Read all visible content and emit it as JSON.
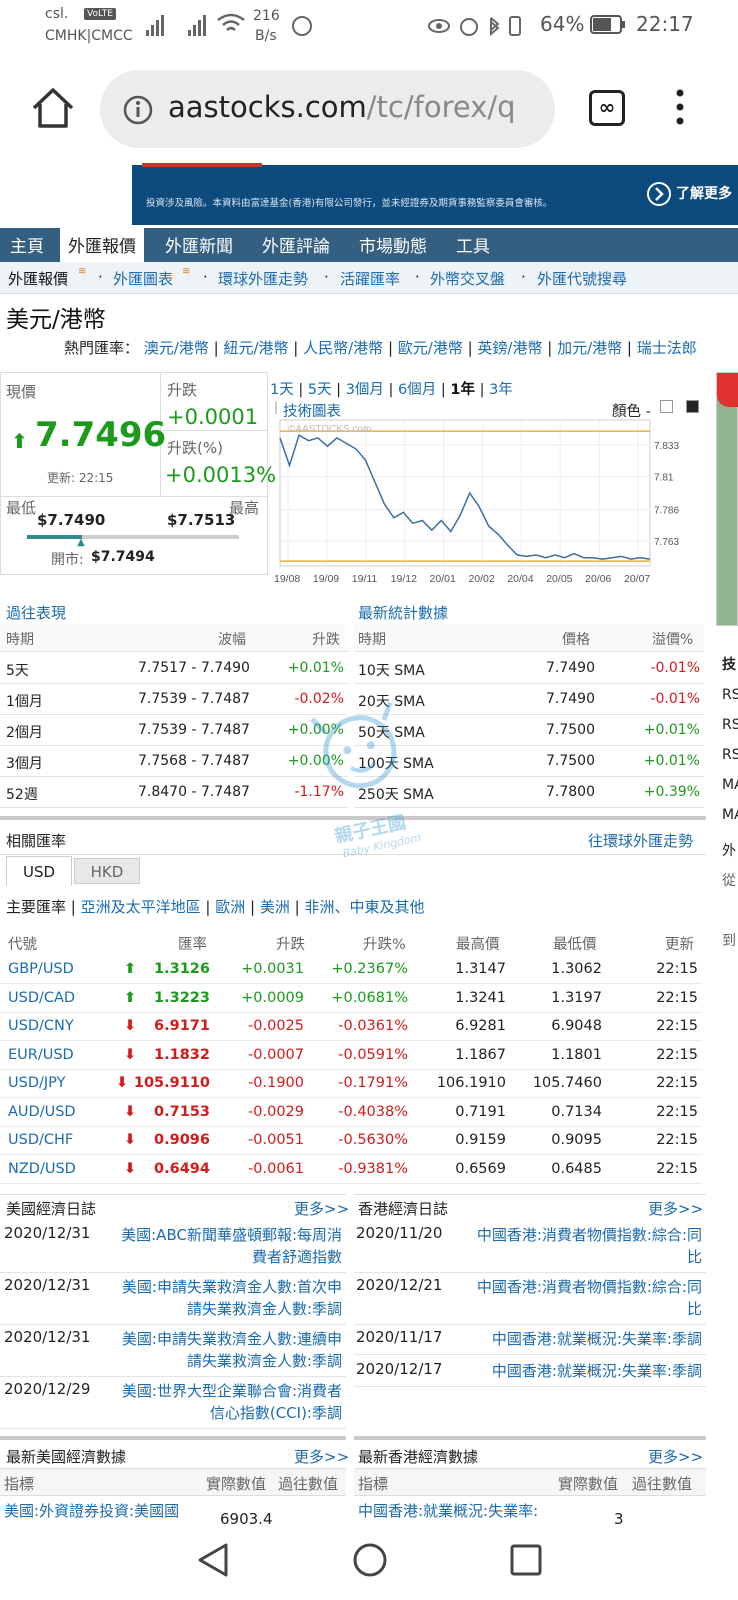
{
  "status": {
    "carrier1": "csl.",
    "volte": "VoLTE",
    "carrier2": "CMHK|CMCC",
    "speed1": "216",
    "speed2": "B/s",
    "battery": "64%",
    "time": "22:17"
  },
  "browser": {
    "url_host": "aastocks.com",
    "url_path": "/tc/forex/q",
    "tabs_icon": "∞"
  },
  "banner": {
    "text": "投資涉及風險。本資料由富達基金(香港)有限公司發行，並未經證券及期貨事務監察委員會審核。",
    "cta": "了解更多"
  },
  "nav": {
    "items": [
      "主頁",
      "外匯報價",
      "外匯新聞",
      "外匯評論",
      "市場動態",
      "工具"
    ]
  },
  "subnav": {
    "items": [
      "外匯報價",
      "外匯圖表",
      "環球外匯走勢",
      "活躍匯率",
      "外幣交叉盤",
      "外匯代號搜尋"
    ]
  },
  "pair": {
    "title": "美元/港幣",
    "hot_label": "熱門匯率：",
    "hot_links": [
      "澳元/港幣",
      "紐元/港幣",
      "人民幣/港幣",
      "歐元/港幣",
      "英鎊/港幣",
      "加元/港幣",
      "瑞士法郎"
    ]
  },
  "quote": {
    "price_label": "現價",
    "price": "7.7496",
    "updated": "更新: 22:15",
    "change_label": "升跌",
    "change": "+0.0001",
    "pct_label": "升跌(%)",
    "pct": "+0.0013%",
    "low_label": "最低",
    "low": "$7.7490",
    "high_label": "最高",
    "high": "$7.7513",
    "open_label": "開市:",
    "open": "$7.7494",
    "range_position": 0.26
  },
  "chart": {
    "periods": [
      "1天",
      "5天",
      "3個月",
      "6個月",
      "1年",
      "3年"
    ],
    "active_period": "1年",
    "tech_link": "技術圖表",
    "color_label": "顏色 -",
    "watermark": "©AASTOCKS.com",
    "x_ticks": [
      "19/08",
      "19/09",
      "19/11",
      "19/12",
      "20/01",
      "20/02",
      "20/04",
      "20/05",
      "20/06",
      "20/07"
    ],
    "y_ticks": [
      "7.833",
      "7.810",
      "7.786",
      "7.763"
    ]
  },
  "chart_data": {
    "type": "line",
    "ylim": [
      7.745,
      7.851
    ],
    "x": [
      "19/08",
      "19/09",
      "19/11",
      "19/12",
      "20/01",
      "20/02",
      "20/04",
      "20/05",
      "20/06",
      "20/07"
    ],
    "series": [
      {
        "values": [
          7.838,
          7.818,
          7.84,
          7.836,
          7.838,
          7.832,
          7.838,
          7.834,
          7.83,
          7.822,
          7.806,
          7.79,
          7.78,
          7.784,
          7.776,
          7.778,
          7.771,
          7.778,
          7.77,
          7.782,
          7.798,
          7.788,
          7.774,
          7.768,
          7.76,
          7.753,
          7.752,
          7.753,
          7.751,
          7.753,
          7.751,
          7.754,
          7.751,
          7.751,
          7.75,
          7.751,
          7.752,
          7.75,
          7.751,
          7.75
        ]
      }
    ],
    "y_ticks": [
      7.833,
      7.81,
      7.786,
      7.763
    ]
  },
  "past": {
    "title": "過往表現",
    "headers": [
      "時期",
      "波幅",
      "升跌"
    ],
    "rows": [
      {
        "period": "5天",
        "range": "7.7517 - 7.7490",
        "chg": "+0.01%",
        "dir": "up"
      },
      {
        "period": "1個月",
        "range": "7.7539 - 7.7487",
        "chg": "-0.02%",
        "dir": "down"
      },
      {
        "period": "2個月",
        "range": "7.7539 - 7.7487",
        "chg": "+0.00%",
        "dir": "up"
      },
      {
        "period": "3個月",
        "range": "7.7568 - 7.7487",
        "chg": "+0.00%",
        "dir": "up"
      },
      {
        "period": "52週",
        "range": "7.8470 - 7.7487",
        "chg": "-1.17%",
        "dir": "down"
      }
    ]
  },
  "stats": {
    "title": "最新統計數據",
    "headers": [
      "時期",
      "價格",
      "溢價%"
    ],
    "rows": [
      {
        "period": "10天 SMA",
        "price": "7.7490",
        "prem": "-0.01%",
        "dir": "down"
      },
      {
        "period": "20天 SMA",
        "price": "7.7490",
        "prem": "-0.01%",
        "dir": "down"
      },
      {
        "period": "50天 SMA",
        "price": "7.7500",
        "prem": "+0.01%",
        "dir": "up"
      },
      {
        "period": "100天 SMA",
        "price": "7.7500",
        "prem": "+0.01%",
        "dir": "up"
      },
      {
        "period": "250天 SMA",
        "price": "7.7800",
        "prem": "+0.39%",
        "dir": "up"
      }
    ]
  },
  "side": {
    "items": [
      "技",
      "RS",
      "RS",
      "RS",
      "MA",
      "MA",
      "外",
      "從",
      "到"
    ]
  },
  "related": {
    "title": "相關匯率",
    "link": "往環球外匯走勢",
    "tabs": [
      "USD",
      "HKD"
    ],
    "regions_label": "主要匯率",
    "regions": [
      "亞洲及太平洋地區",
      "歐洲",
      "美洲",
      "非洲、中東及其他"
    ],
    "headers": [
      "代號",
      "匯率",
      "升跌",
      "升跌%",
      "最高價",
      "最低價",
      "更新"
    ],
    "rows": [
      {
        "sym": "GBP/USD",
        "rate": "1.3126",
        "chg": "+0.0031",
        "pct": "+0.2367%",
        "hi": "1.3147",
        "lo": "1.3062",
        "time": "22:15",
        "dir": "up"
      },
      {
        "sym": "USD/CAD",
        "rate": "1.3223",
        "chg": "+0.0009",
        "pct": "+0.0681%",
        "hi": "1.3241",
        "lo": "1.3197",
        "time": "22:15",
        "dir": "up"
      },
      {
        "sym": "USD/CNY",
        "rate": "6.9171",
        "chg": "-0.0025",
        "pct": "-0.0361%",
        "hi": "6.9281",
        "lo": "6.9048",
        "time": "22:15",
        "dir": "down"
      },
      {
        "sym": "EUR/USD",
        "rate": "1.1832",
        "chg": "-0.0007",
        "pct": "-0.0591%",
        "hi": "1.1867",
        "lo": "1.1801",
        "time": "22:15",
        "dir": "down"
      },
      {
        "sym": "USD/JPY",
        "rate": "105.9110",
        "chg": "-0.1900",
        "pct": "-0.1791%",
        "hi": "106.1910",
        "lo": "105.7460",
        "time": "22:15",
        "dir": "down"
      },
      {
        "sym": "AUD/USD",
        "rate": "0.7153",
        "chg": "-0.0029",
        "pct": "-0.4038%",
        "hi": "0.7191",
        "lo": "0.7134",
        "time": "22:15",
        "dir": "down"
      },
      {
        "sym": "USD/CHF",
        "rate": "0.9096",
        "chg": "-0.0051",
        "pct": "-0.5630%",
        "hi": "0.9159",
        "lo": "0.9095",
        "time": "22:15",
        "dir": "down"
      },
      {
        "sym": "NZD/USD",
        "rate": "0.6494",
        "chg": "-0.0061",
        "pct": "-0.9381%",
        "hi": "0.6569",
        "lo": "0.6485",
        "time": "22:15",
        "dir": "down"
      }
    ]
  },
  "us_cal": {
    "title": "美國經濟日誌",
    "more": "更多>>",
    "items": [
      {
        "date": "2020/12/31",
        "l1": "美國:ABC新聞華盛頓郵報:每周消",
        "l2": "費者舒適指數"
      },
      {
        "date": "2020/12/31",
        "l1": "美國:申請失業救濟金人數:首次申",
        "l2": "請失業救濟金人數:季調"
      },
      {
        "date": "2020/12/31",
        "l1": "美國:申請失業救濟金人數:連續申",
        "l2": "請失業救濟金人數:季調"
      },
      {
        "date": "2020/12/29",
        "l1": "美國:世界大型企業聯合會:消費者",
        "l2": "信心指數(CCI):季調"
      }
    ]
  },
  "hk_cal": {
    "title": "香港經濟日誌",
    "more": "更多>>",
    "items": [
      {
        "date": "2020/11/20",
        "l1": "中國香港:消費者物價指數:綜合:同",
        "l2": "比"
      },
      {
        "date": "2020/12/21",
        "l1": "中國香港:消費者物價指數:綜合:同",
        "l2": "比"
      },
      {
        "date": "2020/11/17",
        "l1": "中國香港:就業概況:失業率:季調",
        "l2": ""
      },
      {
        "date": "2020/12/17",
        "l1": "中國香港:就業概況:失業率:季調",
        "l2": ""
      }
    ]
  },
  "us_data": {
    "title": "最新美國經濟數據",
    "more": "更多>>",
    "headers": [
      "指標",
      "實際數值",
      "過往數值"
    ],
    "row_name": "美國:外資證券投資:美國國",
    "row_val": "6903.4"
  },
  "hk_data": {
    "title": "最新香港經濟數據",
    "more": "更多>>",
    "headers": [
      "指標",
      "實際數值",
      "過往數值"
    ],
    "row_name": "中國香港:就業概況:失業率:",
    "row_val": "3"
  },
  "watermark": {
    "l1": "親子王國",
    "l2": "Baby Kingdom"
  },
  "colors": {
    "nav": "#355f80",
    "up": "#1c9a1c",
    "down": "#d31b1b",
    "link": "#1a6bb0"
  }
}
